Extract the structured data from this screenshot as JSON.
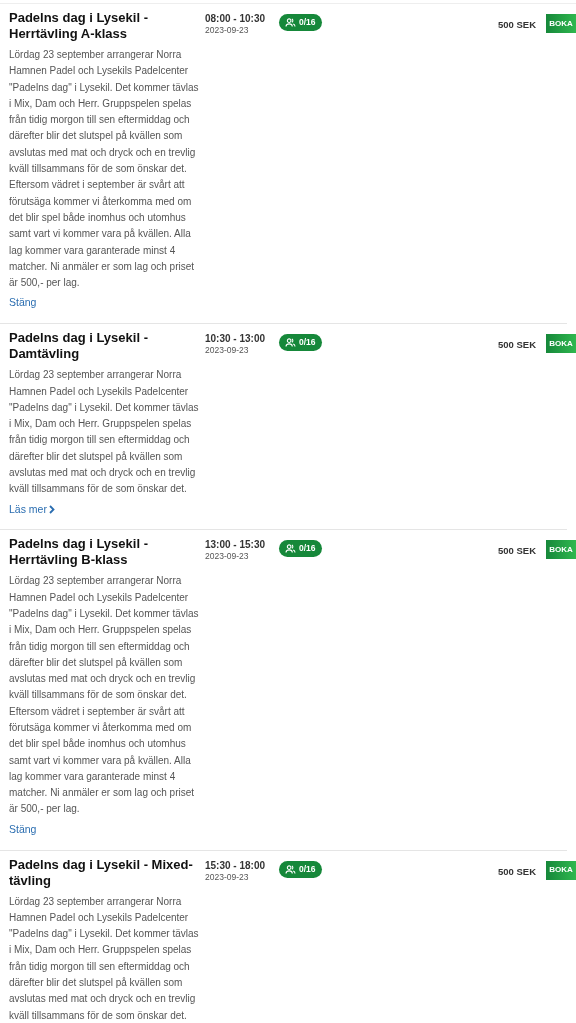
{
  "events": [
    {
      "title": "Padelns dag i Lysekil - Herrtävling A-klass",
      "time": "08:00 - 10:30",
      "date": "2023-09-23",
      "spots": "0/16",
      "price": "500 SEK",
      "button": "BOKA",
      "description": "Lördag 23 september arrangerar Norra Hamnen Padel och Lysekils Padelcenter \"Padelns dag\" i Lysekil. Det kommer tävlas i Mix, Dam och Herr. Gruppspelen spelas från tidig morgon till sen eftermiddag och därefter blir det slutspel på kvällen som avslutas med mat och dryck och en trevlig kväll tillsammans för de som önskar det. Eftersom vädret i september är svårt att förutsäga kommer vi återkomma med om det blir spel både inomhus och utomhus samt vart vi kommer vara på kvällen. Alla lag kommer vara garanterade minst 4 matcher. Ni anmäler er som lag och priset är 500,- per lag.",
      "link": {
        "label": "Stäng",
        "kind": "collapse"
      }
    },
    {
      "title": "Padelns dag i Lysekil - Damtävling",
      "time": "10:30 - 13:00",
      "date": "2023-09-23",
      "spots": "0/16",
      "price": "500 SEK",
      "button": "BOKA",
      "description": "Lördag 23 september arrangerar Norra Hamnen Padel och Lysekils Padelcenter \"Padelns dag\" i Lysekil. Det kommer tävlas i Mix, Dam och Herr. Gruppspelen spelas från tidig morgon till sen eftermiddag och därefter blir det slutspel på kvällen som avslutas med mat och dryck och en trevlig kväll tillsammans för de som önskar det.",
      "link": {
        "label": "Läs mer",
        "kind": "expand"
      }
    },
    {
      "title": "Padelns dag i Lysekil - Herrtävling B-klass",
      "time": "13:00 - 15:30",
      "date": "2023-09-23",
      "spots": "0/16",
      "price": "500 SEK",
      "button": "BOKA",
      "description": "Lördag 23 september arrangerar Norra Hamnen Padel och Lysekils Padelcenter \"Padelns dag\" i Lysekil. Det kommer tävlas i Mix, Dam och Herr. Gruppspelen spelas från tidig morgon till sen eftermiddag och därefter blir det slutspel på kvällen som avslutas med mat och dryck och en trevlig kväll tillsammans för de som önskar det. Eftersom vädret i september är svårt att förutsäga kommer vi återkomma med om det blir spel både inomhus och utomhus samt vart vi kommer vara på kvällen. Alla lag kommer vara garanterade minst 4 matcher. Ni anmäler er som lag och priset är 500,- per lag.",
      "link": {
        "label": "Stäng",
        "kind": "collapse"
      }
    },
    {
      "title": "Padelns dag i Lysekil - Mixed-tävling",
      "time": "15:30 - 18:00",
      "date": "2023-09-23",
      "spots": "0/16",
      "price": "500 SEK",
      "button": "BOKA",
      "description": "Lördag 23 september arrangerar Norra Hamnen Padel och Lysekils Padelcenter \"Padelns dag\" i Lysekil. Det kommer tävlas i Mix, Dam och Herr. Gruppspelen spelas från tidig morgon till sen eftermiddag och därefter blir det slutspel på kvällen som avslutas med mat och dryck och en trevlig kväll tillsammans för de som önskar det."
    }
  ]
}
